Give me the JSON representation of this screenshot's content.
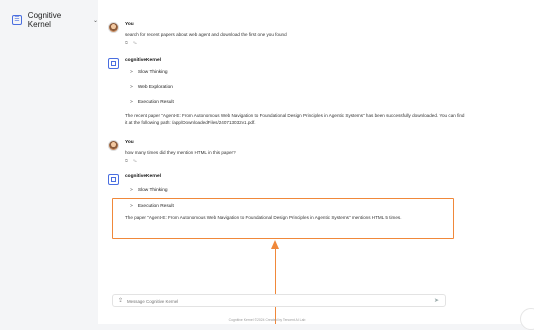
{
  "sidebar": {
    "app_title": "Cognitive Kernel"
  },
  "conversation": {
    "m1": {
      "sender": "You",
      "text": "search for recent papers about web agent and download the first one you found",
      "tools": "⧉ ✎"
    },
    "m2": {
      "sender": "cognitiveKernel",
      "steps": [
        "Slow Thinking",
        "Web Exploration",
        "Execution Result"
      ],
      "text": "The recent paper \"Agent-E: From Autonomous Web Navigation to Foundational Design Principles in Agentic Systems\" has been successfully downloaded. You can find it at the following path: /app/DownloadedFiles/240713032v1.pdf."
    },
    "m3": {
      "sender": "You",
      "text": "how many times did they mention HTML in this paper?",
      "tools": "⧉ ✎"
    },
    "m4": {
      "sender": "cognitiveKernel",
      "steps": [
        "Slow Thinking",
        "Execution Result"
      ],
      "text": "The paper \"Agent-E: From Autonomous Web Navigation to Foundational Design Principles in Agentic Systems\" mentions HTML 5 times."
    }
  },
  "composer": {
    "placeholder": "Message Cognitive Kernel"
  },
  "footer": {
    "text": "Cognitive Kernel ©2024 Created by Tencent AI Lab"
  },
  "colors": {
    "highlight": "#f0883a",
    "brand_blue": "#4a6ee0"
  },
  "icons": {
    "brand": "kernel-logo-icon",
    "dropdown": "chevron-down-icon",
    "expand": "chevron-right-icon",
    "upload": "upload-icon",
    "send": "send-icon"
  }
}
